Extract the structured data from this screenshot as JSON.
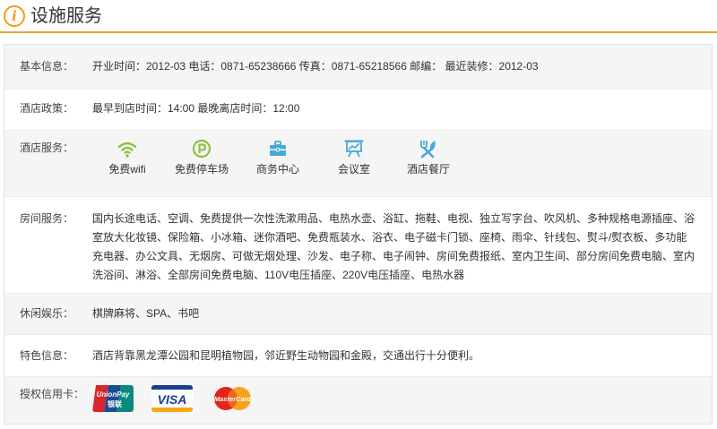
{
  "header": {
    "icon": "info-icon",
    "icon_glyph": "i",
    "title": "设施服务",
    "accent": "#f59a12"
  },
  "rows": {
    "basic": {
      "label": "基本信息：",
      "value": "开业时间：2012-03 电话：0871-65238666 传真：0871-65218566 邮编： 最近装修：2012-03"
    },
    "policy": {
      "label": "酒店政策：",
      "value": "最早到店时间：14:00 最晚离店时间：12:00"
    },
    "hotel_services": {
      "label": "酒店服务：",
      "items": [
        {
          "icon": "wifi-icon",
          "label": "免费wifi"
        },
        {
          "icon": "parking-icon",
          "label": "免费停车场"
        },
        {
          "icon": "briefcase-icon",
          "label": "商务中心"
        },
        {
          "icon": "meeting-room-icon",
          "label": "会议室"
        },
        {
          "icon": "restaurant-icon",
          "label": "酒店餐厅"
        }
      ],
      "icon_colors": {
        "wifi": "#8dc03e",
        "parking": "#8dc03e",
        "business": "#48a8d8",
        "meeting": "#48a8d8",
        "restaurant": "#48a8d8"
      }
    },
    "room_services": {
      "label": "房间服务：",
      "value": "国内长途电话、空调、免费提供一次性洗漱用品、电热水壶、浴缸、拖鞋、电视、独立写字台、吹风机、多种规格电源插座、浴室放大化妆镜、保险箱、小冰箱、迷你酒吧、免费瓶装水、浴衣、电子磁卡门锁、座椅、雨伞、针线包、熨斗/熨衣板、多功能充电器、办公文具、无烟房、可做无烟处理、沙发、电子称、电子闹钟、房间免费报纸、室内卫生间、部分房间免费电脑、室内洗浴间、淋浴、全部房间免费电脑、110V电压插座、220V电压插座、电热水器"
    },
    "leisure": {
      "label": "休闲娱乐：",
      "value": "棋牌麻将、SPA、书吧"
    },
    "features": {
      "label": "特色信息：",
      "value": "酒店背靠黑龙潭公园和昆明植物园，邻近野生动物园和金殿，交通出行十分便利。"
    },
    "cards": {
      "label": "授权信用卡：",
      "items": [
        {
          "icon": "unionpay-logo",
          "text_line1": "UnionPay",
          "text_line2": "银联"
        },
        {
          "icon": "visa-logo",
          "text": "VISA"
        },
        {
          "icon": "mastercard-logo",
          "text": "MasterCard"
        }
      ]
    }
  }
}
